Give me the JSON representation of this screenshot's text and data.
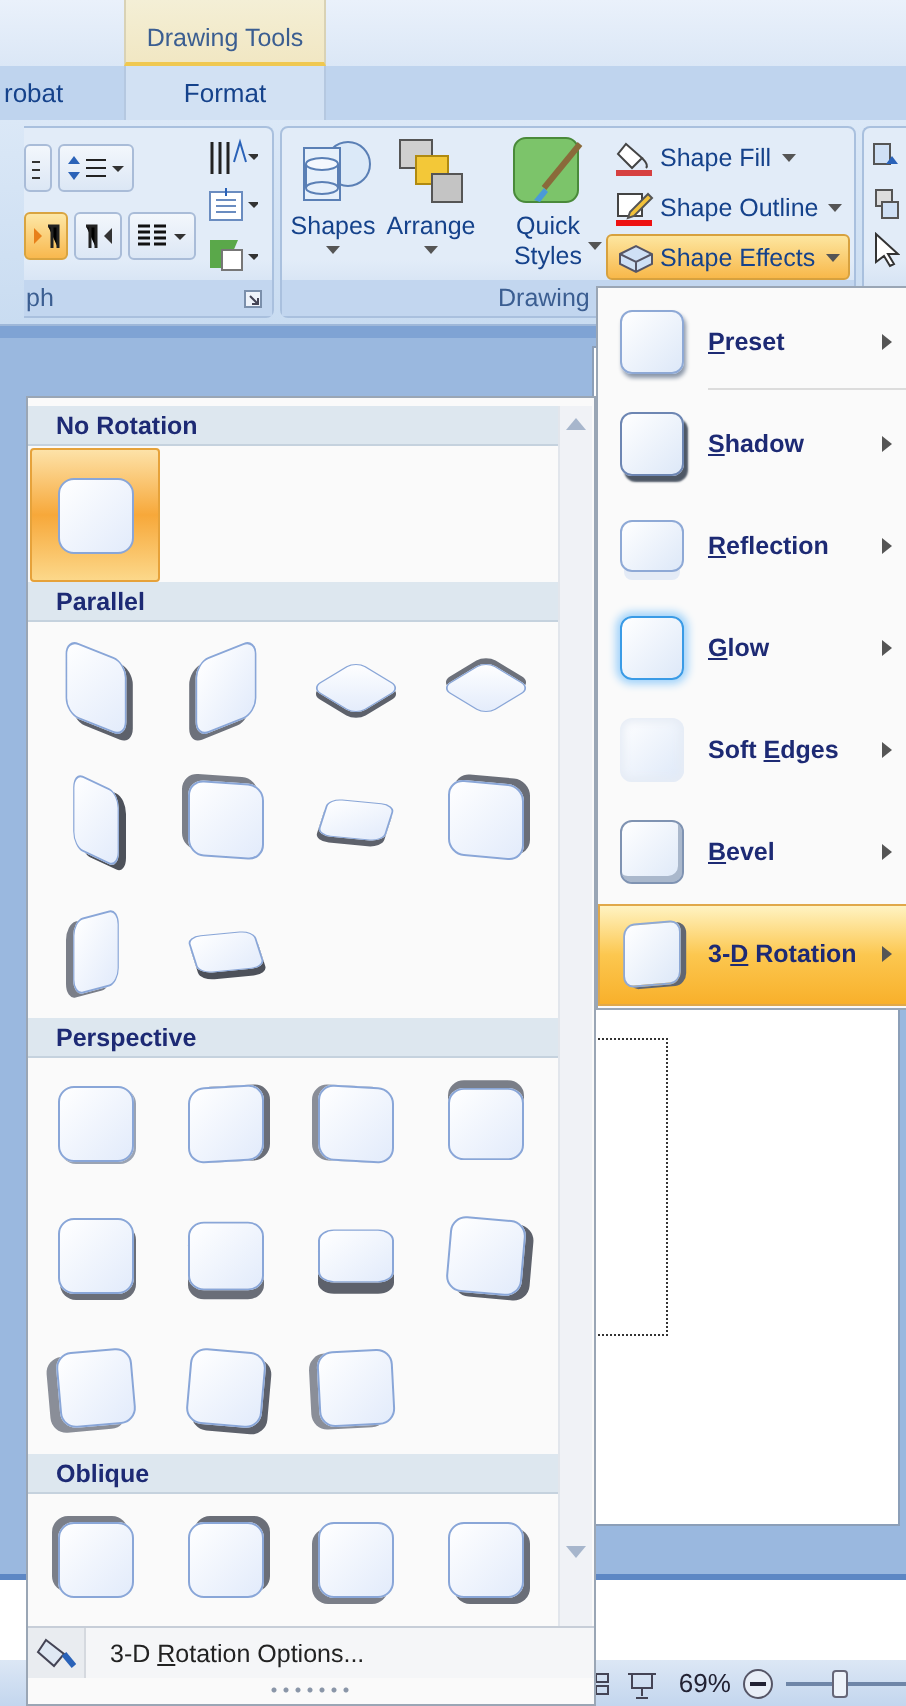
{
  "contextual_tab": {
    "title": "Drawing Tools"
  },
  "tabs": [
    {
      "label": "robat",
      "selected": false
    },
    {
      "label": "Format",
      "selected": true
    }
  ],
  "ribbon": {
    "paragraph_group": {
      "label": "ph"
    },
    "drawing_group": {
      "label": "Drawing",
      "large_buttons": [
        {
          "label": "Shapes",
          "kind": "shapes"
        },
        {
          "label": "Arrange",
          "kind": "arrange"
        },
        {
          "label": "Quick Styles",
          "kind": "styles"
        }
      ],
      "small_buttons": [
        {
          "label": "Shape Fill",
          "kind": "fill",
          "selected": false
        },
        {
          "label": "Shape Outline",
          "kind": "outline",
          "selected": false
        },
        {
          "label": "Shape Effects",
          "kind": "effects",
          "selected": true
        }
      ]
    }
  },
  "gallery": {
    "sections": [
      {
        "title": "No Rotation",
        "items": [
          {
            "kind": "none",
            "selected": true
          }
        ]
      },
      {
        "title": "Parallel",
        "items": [
          {
            "kind": "p1",
            "selected": false
          },
          {
            "kind": "p2",
            "selected": false
          },
          {
            "kind": "p3",
            "selected": false
          },
          {
            "kind": "p4",
            "selected": false
          },
          {
            "kind": "p5",
            "selected": false
          },
          {
            "kind": "p6",
            "selected": false
          },
          {
            "kind": "p7",
            "selected": false
          },
          {
            "kind": "p8",
            "selected": false
          },
          {
            "kind": "p9",
            "selected": false
          },
          {
            "kind": "p10",
            "selected": false
          }
        ]
      },
      {
        "title": "Perspective",
        "items": [
          {
            "kind": "s1",
            "selected": false
          },
          {
            "kind": "s2",
            "selected": false
          },
          {
            "kind": "s3",
            "selected": false
          },
          {
            "kind": "s4",
            "selected": false
          },
          {
            "kind": "s5",
            "selected": false
          },
          {
            "kind": "s6",
            "selected": false
          },
          {
            "kind": "s7",
            "selected": false
          },
          {
            "kind": "s8",
            "selected": false
          },
          {
            "kind": "s9",
            "selected": false
          },
          {
            "kind": "s10",
            "selected": false
          },
          {
            "kind": "s11",
            "selected": false
          }
        ]
      },
      {
        "title": "Oblique",
        "items": [
          {
            "kind": "o1",
            "selected": false
          },
          {
            "kind": "o2",
            "selected": false
          },
          {
            "kind": "o3",
            "selected": false
          },
          {
            "kind": "o4",
            "selected": false
          }
        ]
      }
    ],
    "footer": {
      "before": "3-D ",
      "key": "R",
      "after": "otation Options..."
    }
  },
  "effects_menu": [
    {
      "kind": "preset",
      "key": "P",
      "after": "reset",
      "selected": false
    },
    {
      "kind": "shadow",
      "key": "S",
      "after": "hadow",
      "selected": false
    },
    {
      "kind": "reflection",
      "key": "R",
      "after": "eflection",
      "selected": false
    },
    {
      "kind": "glow",
      "key": "G",
      "after": "low",
      "selected": false
    },
    {
      "kind": "soft",
      "before": "Soft ",
      "key": "E",
      "after": "dges",
      "selected": false
    },
    {
      "kind": "bevel",
      "key": "B",
      "after": "evel",
      "selected": false
    },
    {
      "kind": "rotation",
      "before": "3-",
      "key": "D",
      "after": " Rotation",
      "selected": true
    }
  ],
  "status_bar": {
    "zoom": "69%",
    "zoom_slider": {
      "level": 0.45
    }
  }
}
